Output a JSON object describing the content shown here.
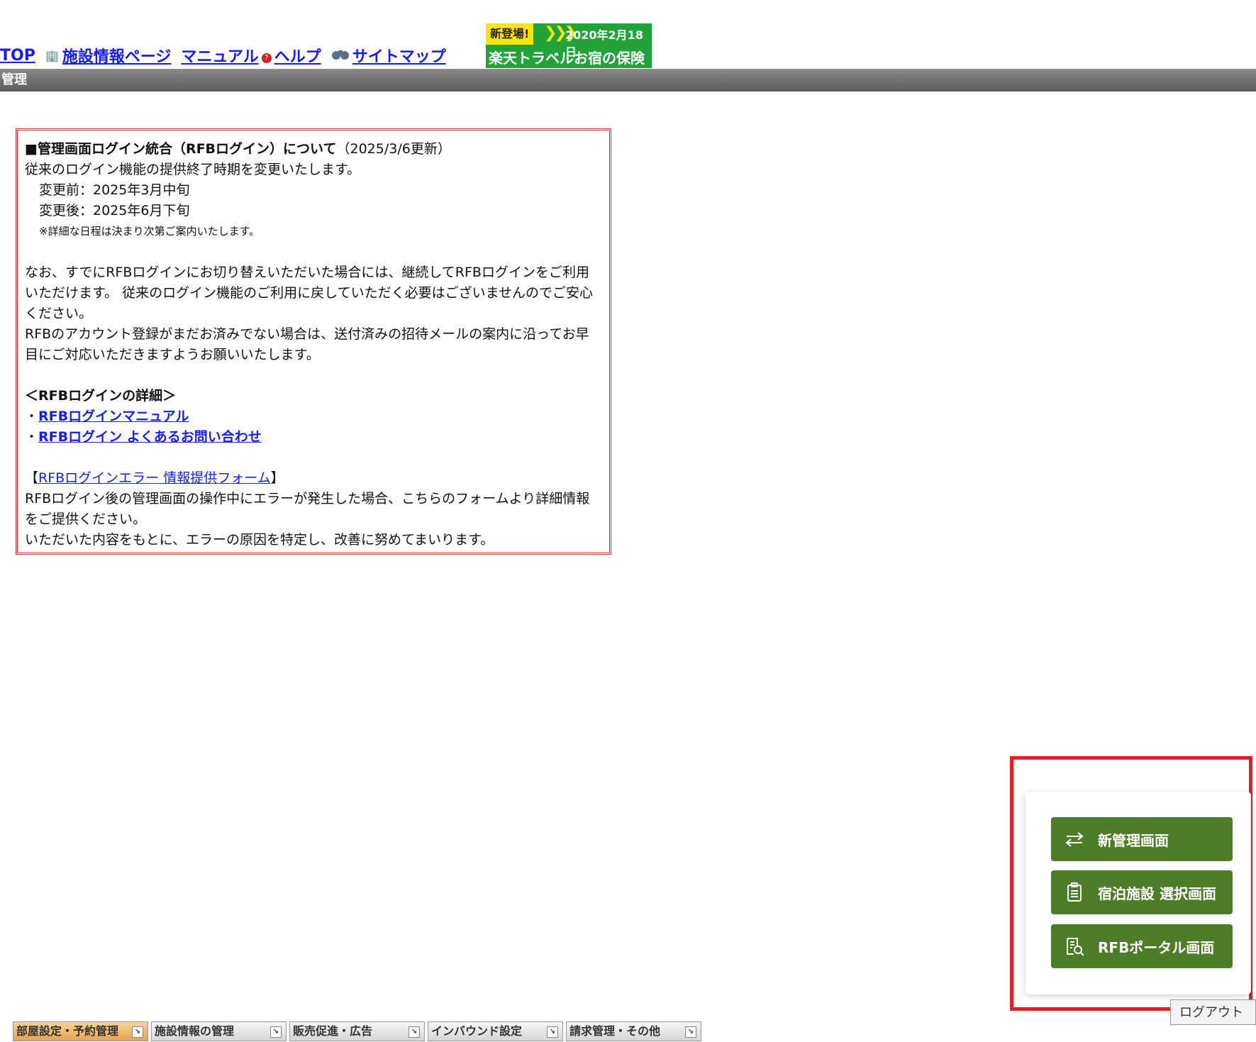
{
  "nav": {
    "top_label": "TOP",
    "facility_label": "施設情報ページ",
    "manual_label": "マニュアル",
    "help_label": "ヘルプ",
    "sitemap_label": "サイトマップ"
  },
  "banner": {
    "new_label": "新登場!",
    "date": "2020年2月18日",
    "title": "楽天トラベルお宿の保険"
  },
  "section_bar": {
    "title": "管理"
  },
  "notice": {
    "heading": "■管理画面ログイン統合（RFBログイン）について",
    "heading_date": "（2025/3/6更新）",
    "line1": "従来のログイン機能の提供終了時期を変更いたします。",
    "before": "変更前：2025年3月中旬",
    "after": "変更後：2025年6月下旬",
    "note": "※詳細な日程は決まり次第ご案内いたします。",
    "para1": "なお、すでにRFBログインにお切り替えいただいた場合には、継続してRFBログインをご利用いただけます。 従来のログイン機能のご利用に戻していただく必要はございませんのでご安心ください。",
    "para2": "RFBのアカウント登録がまだお済みでない場合は、送付済みの招待メールの案内に沿ってお早目にご対応いただきますようお願いいたします。",
    "details_heading": "＜RFBログインの詳細＞",
    "bullet": "・",
    "link_manual": "RFBログインマニュアル",
    "link_faq": "RFBログイン よくあるお問い合わせ",
    "bracket_open": "【",
    "bracket_close": "】",
    "link_error_form": "RFBログインエラー 情報提供フォーム",
    "para3": "RFBログイン後の管理画面の操作中にエラーが発生した場合、こちらのフォームより詳細情報をご提供ください。",
    "para4": "いただいた内容をもとに、エラーの原因を特定し、改善に努めてまいります。"
  },
  "portal": {
    "new_admin_label": "新管理画面",
    "facility_select_label": "宿泊施設 選択画面",
    "rfb_portal_label": "RFBポータル画面",
    "logout_label": "ログアウト"
  },
  "tabs": [
    {
      "label": "部屋設定・予約管理"
    },
    {
      "label": "施設情報の管理"
    },
    {
      "label": "販売促進・広告"
    },
    {
      "label": "インバウンド設定"
    },
    {
      "label": "請求管理・その他"
    }
  ]
}
